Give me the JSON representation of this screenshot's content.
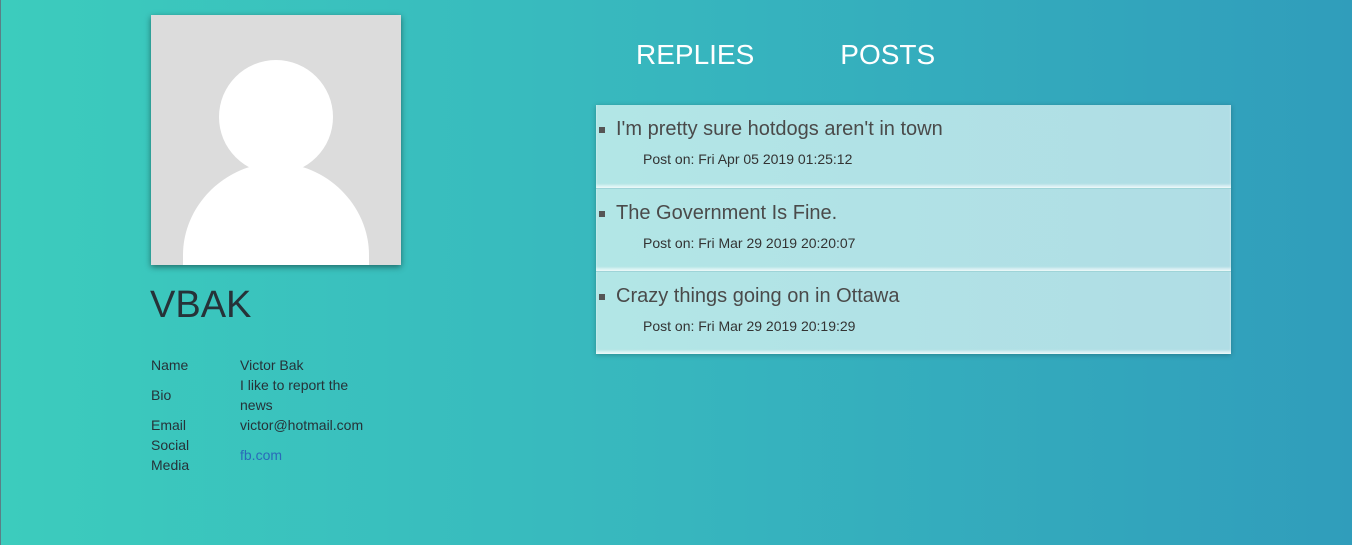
{
  "profile": {
    "username": "VBAK",
    "fields": {
      "name_label": "Name",
      "name_value": "Victor Bak",
      "bio_label": "Bio",
      "bio_value": "I like to report the news",
      "email_label": "Email",
      "email_value": "victor@hotmail.com",
      "social_label": "Social Media",
      "social_value": "fb.com"
    },
    "avatar_icon": "default-user-avatar-icon"
  },
  "tabs": [
    {
      "label": "REPLIES"
    },
    {
      "label": "POSTS"
    }
  ],
  "posts": [
    {
      "title": "I'm pretty sure hotdogs aren't in town",
      "date": "Post on: Fri Apr 05 2019 01:25:12"
    },
    {
      "title": "The Government Is Fine.",
      "date": "Post on: Fri Mar 29 2019 20:20:07"
    },
    {
      "title": "Crazy things going on in Ottawa",
      "date": "Post on: Fri Mar 29 2019 20:19:29"
    }
  ],
  "colors": {
    "background_start": "#3cccbd",
    "background_end": "#309dbb",
    "link": "#2a6ab9",
    "tab_text": "#ffffff"
  }
}
